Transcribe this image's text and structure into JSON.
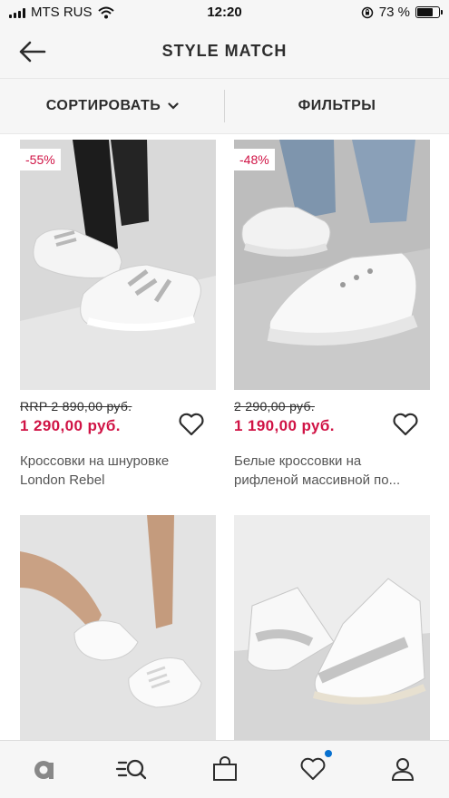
{
  "status_bar": {
    "carrier": "MTS RUS",
    "time": "12:20",
    "battery": "73 %",
    "battery_level": 0.73
  },
  "header": {
    "title": "STYLE MATCH"
  },
  "toolbar": {
    "sort_label": "СОРТИРОВАТЬ",
    "filter_label": "ФИЛЬТРЫ"
  },
  "products": [
    {
      "badge": "-55%",
      "old_price": "RRP 2 890,00 руб.",
      "price": "1 290,00 руб.",
      "title_line1": "Кроссовки на шнуровке",
      "title_line2": "London Rebel"
    },
    {
      "badge": "-48%",
      "old_price": "2 290,00 руб.",
      "price": "1 190,00 руб.",
      "title_line1": "Белые кроссовки на",
      "title_line2": "рифленой массивной по..."
    },
    {
      "badge": "",
      "old_price": "",
      "price": "",
      "title_line1": "",
      "title_line2": ""
    },
    {
      "badge": "",
      "old_price": "",
      "price": "",
      "title_line1": "",
      "title_line2": ""
    }
  ],
  "tabbar": {
    "items": [
      "home-icon",
      "search-icon",
      "bag-icon",
      "saved-icon",
      "account-icon"
    ],
    "saved_has_badge": true
  },
  "colors": {
    "sale_red": "#d01345",
    "notification_blue": "#0770cf",
    "text_dark": "#2d2d2d"
  }
}
